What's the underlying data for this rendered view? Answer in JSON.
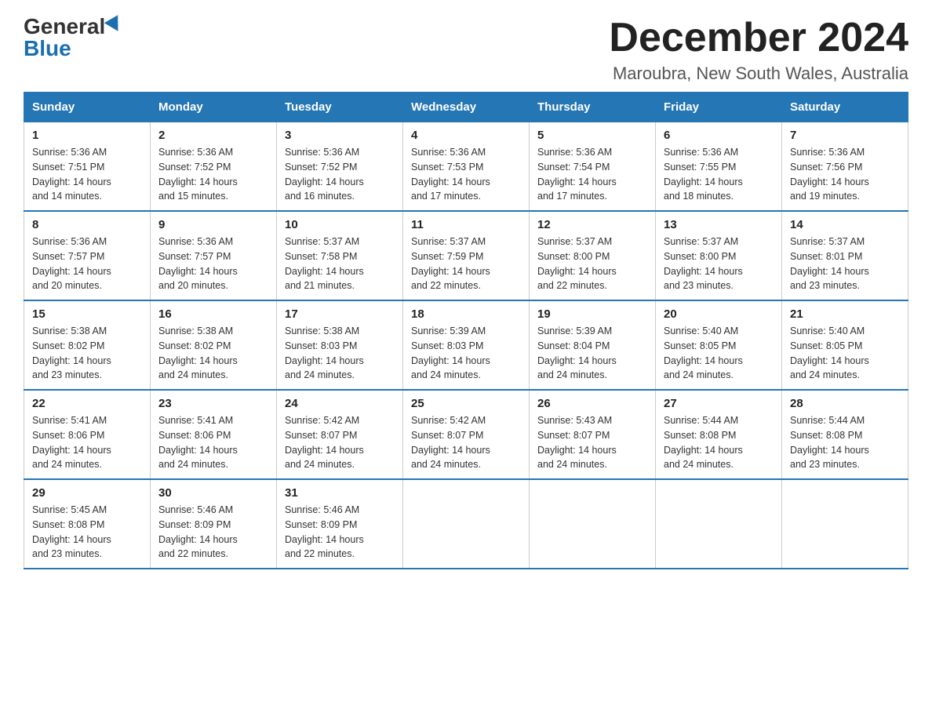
{
  "header": {
    "logo_general": "General",
    "logo_blue": "Blue",
    "month_title": "December 2024",
    "location": "Maroubra, New South Wales, Australia"
  },
  "days_of_week": [
    "Sunday",
    "Monday",
    "Tuesday",
    "Wednesday",
    "Thursday",
    "Friday",
    "Saturday"
  ],
  "weeks": [
    [
      {
        "day": "1",
        "sunrise": "5:36 AM",
        "sunset": "7:51 PM",
        "daylight": "14 hours and 14 minutes."
      },
      {
        "day": "2",
        "sunrise": "5:36 AM",
        "sunset": "7:52 PM",
        "daylight": "14 hours and 15 minutes."
      },
      {
        "day": "3",
        "sunrise": "5:36 AM",
        "sunset": "7:52 PM",
        "daylight": "14 hours and 16 minutes."
      },
      {
        "day": "4",
        "sunrise": "5:36 AM",
        "sunset": "7:53 PM",
        "daylight": "14 hours and 17 minutes."
      },
      {
        "day": "5",
        "sunrise": "5:36 AM",
        "sunset": "7:54 PM",
        "daylight": "14 hours and 17 minutes."
      },
      {
        "day": "6",
        "sunrise": "5:36 AM",
        "sunset": "7:55 PM",
        "daylight": "14 hours and 18 minutes."
      },
      {
        "day": "7",
        "sunrise": "5:36 AM",
        "sunset": "7:56 PM",
        "daylight": "14 hours and 19 minutes."
      }
    ],
    [
      {
        "day": "8",
        "sunrise": "5:36 AM",
        "sunset": "7:57 PM",
        "daylight": "14 hours and 20 minutes."
      },
      {
        "day": "9",
        "sunrise": "5:36 AM",
        "sunset": "7:57 PM",
        "daylight": "14 hours and 20 minutes."
      },
      {
        "day": "10",
        "sunrise": "5:37 AM",
        "sunset": "7:58 PM",
        "daylight": "14 hours and 21 minutes."
      },
      {
        "day": "11",
        "sunrise": "5:37 AM",
        "sunset": "7:59 PM",
        "daylight": "14 hours and 22 minutes."
      },
      {
        "day": "12",
        "sunrise": "5:37 AM",
        "sunset": "8:00 PM",
        "daylight": "14 hours and 22 minutes."
      },
      {
        "day": "13",
        "sunrise": "5:37 AM",
        "sunset": "8:00 PM",
        "daylight": "14 hours and 23 minutes."
      },
      {
        "day": "14",
        "sunrise": "5:37 AM",
        "sunset": "8:01 PM",
        "daylight": "14 hours and 23 minutes."
      }
    ],
    [
      {
        "day": "15",
        "sunrise": "5:38 AM",
        "sunset": "8:02 PM",
        "daylight": "14 hours and 23 minutes."
      },
      {
        "day": "16",
        "sunrise": "5:38 AM",
        "sunset": "8:02 PM",
        "daylight": "14 hours and 24 minutes."
      },
      {
        "day": "17",
        "sunrise": "5:38 AM",
        "sunset": "8:03 PM",
        "daylight": "14 hours and 24 minutes."
      },
      {
        "day": "18",
        "sunrise": "5:39 AM",
        "sunset": "8:03 PM",
        "daylight": "14 hours and 24 minutes."
      },
      {
        "day": "19",
        "sunrise": "5:39 AM",
        "sunset": "8:04 PM",
        "daylight": "14 hours and 24 minutes."
      },
      {
        "day": "20",
        "sunrise": "5:40 AM",
        "sunset": "8:05 PM",
        "daylight": "14 hours and 24 minutes."
      },
      {
        "day": "21",
        "sunrise": "5:40 AM",
        "sunset": "8:05 PM",
        "daylight": "14 hours and 24 minutes."
      }
    ],
    [
      {
        "day": "22",
        "sunrise": "5:41 AM",
        "sunset": "8:06 PM",
        "daylight": "14 hours and 24 minutes."
      },
      {
        "day": "23",
        "sunrise": "5:41 AM",
        "sunset": "8:06 PM",
        "daylight": "14 hours and 24 minutes."
      },
      {
        "day": "24",
        "sunrise": "5:42 AM",
        "sunset": "8:07 PM",
        "daylight": "14 hours and 24 minutes."
      },
      {
        "day": "25",
        "sunrise": "5:42 AM",
        "sunset": "8:07 PM",
        "daylight": "14 hours and 24 minutes."
      },
      {
        "day": "26",
        "sunrise": "5:43 AM",
        "sunset": "8:07 PM",
        "daylight": "14 hours and 24 minutes."
      },
      {
        "day": "27",
        "sunrise": "5:44 AM",
        "sunset": "8:08 PM",
        "daylight": "14 hours and 24 minutes."
      },
      {
        "day": "28",
        "sunrise": "5:44 AM",
        "sunset": "8:08 PM",
        "daylight": "14 hours and 23 minutes."
      }
    ],
    [
      {
        "day": "29",
        "sunrise": "5:45 AM",
        "sunset": "8:08 PM",
        "daylight": "14 hours and 23 minutes."
      },
      {
        "day": "30",
        "sunrise": "5:46 AM",
        "sunset": "8:09 PM",
        "daylight": "14 hours and 22 minutes."
      },
      {
        "day": "31",
        "sunrise": "5:46 AM",
        "sunset": "8:09 PM",
        "daylight": "14 hours and 22 minutes."
      },
      null,
      null,
      null,
      null
    ]
  ],
  "labels": {
    "sunrise": "Sunrise:",
    "sunset": "Sunset:",
    "daylight": "Daylight:"
  }
}
